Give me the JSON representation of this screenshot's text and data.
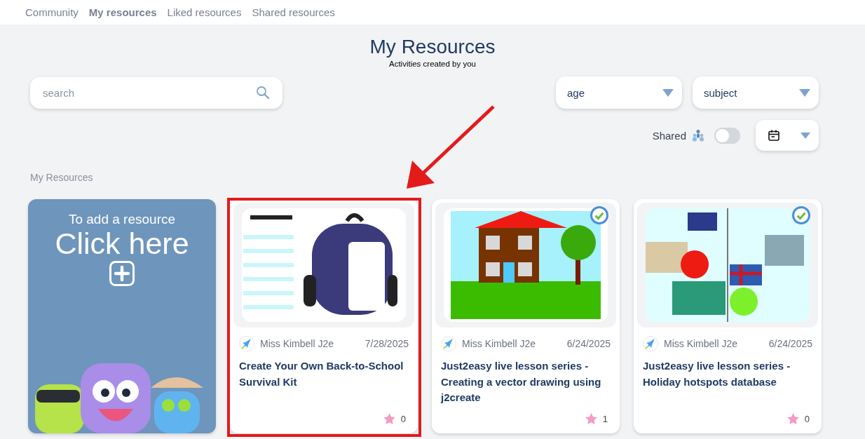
{
  "nav": [
    {
      "label": "Community",
      "selected": false
    },
    {
      "label": "My resources",
      "selected": true
    },
    {
      "label": "Liked resources",
      "selected": false
    },
    {
      "label": "Shared resources",
      "selected": false
    }
  ],
  "header": {
    "title": "My Resources",
    "subtitle": "Activities created by you"
  },
  "search": {
    "placeholder": "search"
  },
  "filters": [
    {
      "label": "age"
    },
    {
      "label": "subject"
    }
  ],
  "shared_toggle": {
    "label": "Shared",
    "on": false
  },
  "section_label": "My Resources",
  "add_card": {
    "line_1": "To add a resource",
    "line_2": "Click here"
  },
  "resources": [
    {
      "thumbnail": {
        "kind": "worksheet"
      },
      "verified": false,
      "highlighted": true,
      "author": "Miss Kimbell J2e",
      "date": "7/28/2025",
      "title": "Create Your Own Back-to-School Survival Kit",
      "likes": "0"
    },
    {
      "thumbnail": {
        "kind": "house"
      },
      "verified": true,
      "highlighted": false,
      "author": "Miss Kimbell J2e",
      "date": "6/24/2025",
      "title": "Just2easy live lesson series - Creating a vector drawing using j2create",
      "likes": "1"
    },
    {
      "thumbnail": {
        "kind": "collage"
      },
      "verified": true,
      "highlighted": false,
      "author": "Miss Kimbell J2e",
      "date": "6/24/2025",
      "title": "Just2easy live lesson series - Holiday hotspots database",
      "likes": "0"
    }
  ]
}
